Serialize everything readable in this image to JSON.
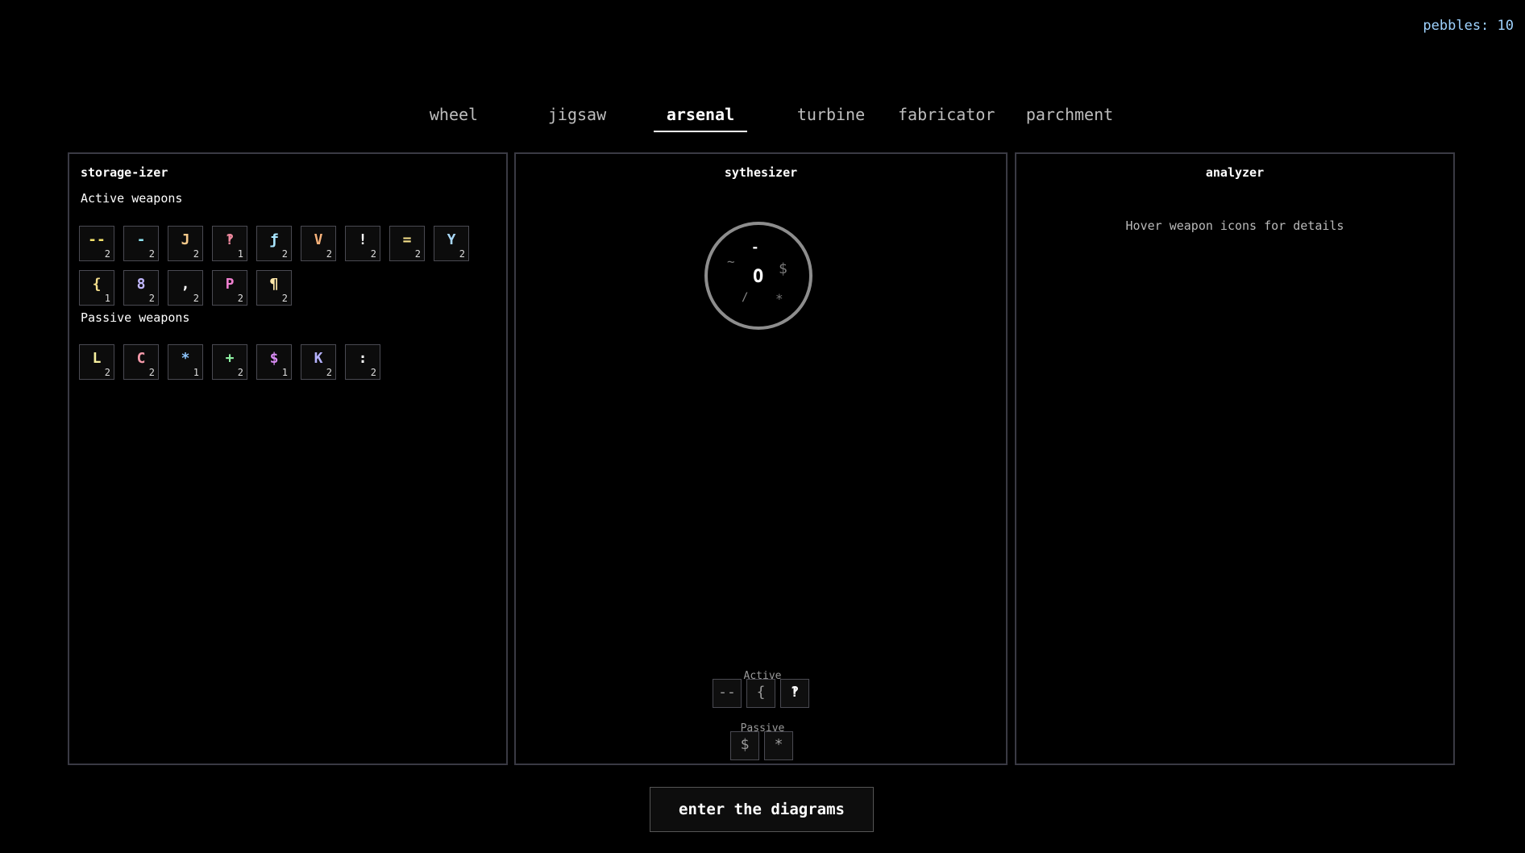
{
  "pebbles": "pebbles: 10",
  "tabs": [
    "wheel",
    "jigsaw",
    "arsenal",
    "turbine",
    "fabricator",
    "parchment"
  ],
  "active_tab": "arsenal",
  "storage": {
    "title": "storage-izer",
    "active_label": "Active weapons",
    "passive_label": "Passive weapons",
    "active": [
      {
        "glyph": "--",
        "count": "2",
        "color": "#f2e06b"
      },
      {
        "glyph": "-",
        "count": "2",
        "color": "#8fe3f0"
      },
      {
        "glyph": "J",
        "count": "2",
        "color": "#f7c98a"
      },
      {
        "glyph": "‽",
        "count": "1",
        "color": "#f28aa0"
      },
      {
        "glyph": "ƒ",
        "count": "2",
        "color": "#a9e6ff"
      },
      {
        "glyph": "V",
        "count": "2",
        "color": "#f7b27a"
      },
      {
        "glyph": "!",
        "count": "2",
        "color": "#ffffff"
      },
      {
        "glyph": "=",
        "count": "2",
        "color": "#f7e28a"
      },
      {
        "glyph": "Y",
        "count": "2",
        "color": "#a9d8f7"
      },
      {
        "glyph": "{",
        "count": "1",
        "color": "#f5df8c"
      },
      {
        "glyph": "8",
        "count": "2",
        "color": "#c2b8ff"
      },
      {
        "glyph": ",",
        "count": "2",
        "color": "#ffffff"
      },
      {
        "glyph": "P",
        "count": "2",
        "color": "#ef7fcf"
      },
      {
        "glyph": "¶",
        "count": "2",
        "color": "#ffe7a8"
      }
    ],
    "passive": [
      {
        "glyph": "L",
        "count": "2",
        "color": "#f6ef9e"
      },
      {
        "glyph": "C",
        "count": "2",
        "color": "#f59aaa"
      },
      {
        "glyph": "*",
        "count": "1",
        "color": "#8fc7ff"
      },
      {
        "glyph": "+",
        "count": "2",
        "color": "#8ef0a2"
      },
      {
        "glyph": "$",
        "count": "1",
        "color": "#d98cf5"
      },
      {
        "glyph": "K",
        "count": "2",
        "color": "#b5b2ff"
      },
      {
        "glyph": ":",
        "count": "2",
        "color": "#ffffff"
      }
    ]
  },
  "synth": {
    "title": "sythesizer",
    "center": "O",
    "orbit": [
      "-",
      "~",
      "$",
      "/",
      "*"
    ],
    "active_label": "Active",
    "passive_label": "Passive",
    "active_slots": [
      "--",
      "{",
      "‽"
    ],
    "passive_slots": [
      "$",
      "*"
    ]
  },
  "analyzer": {
    "title": "analyzer",
    "hint": "Hover weapon icons for details"
  },
  "enter_button": "enter the diagrams"
}
